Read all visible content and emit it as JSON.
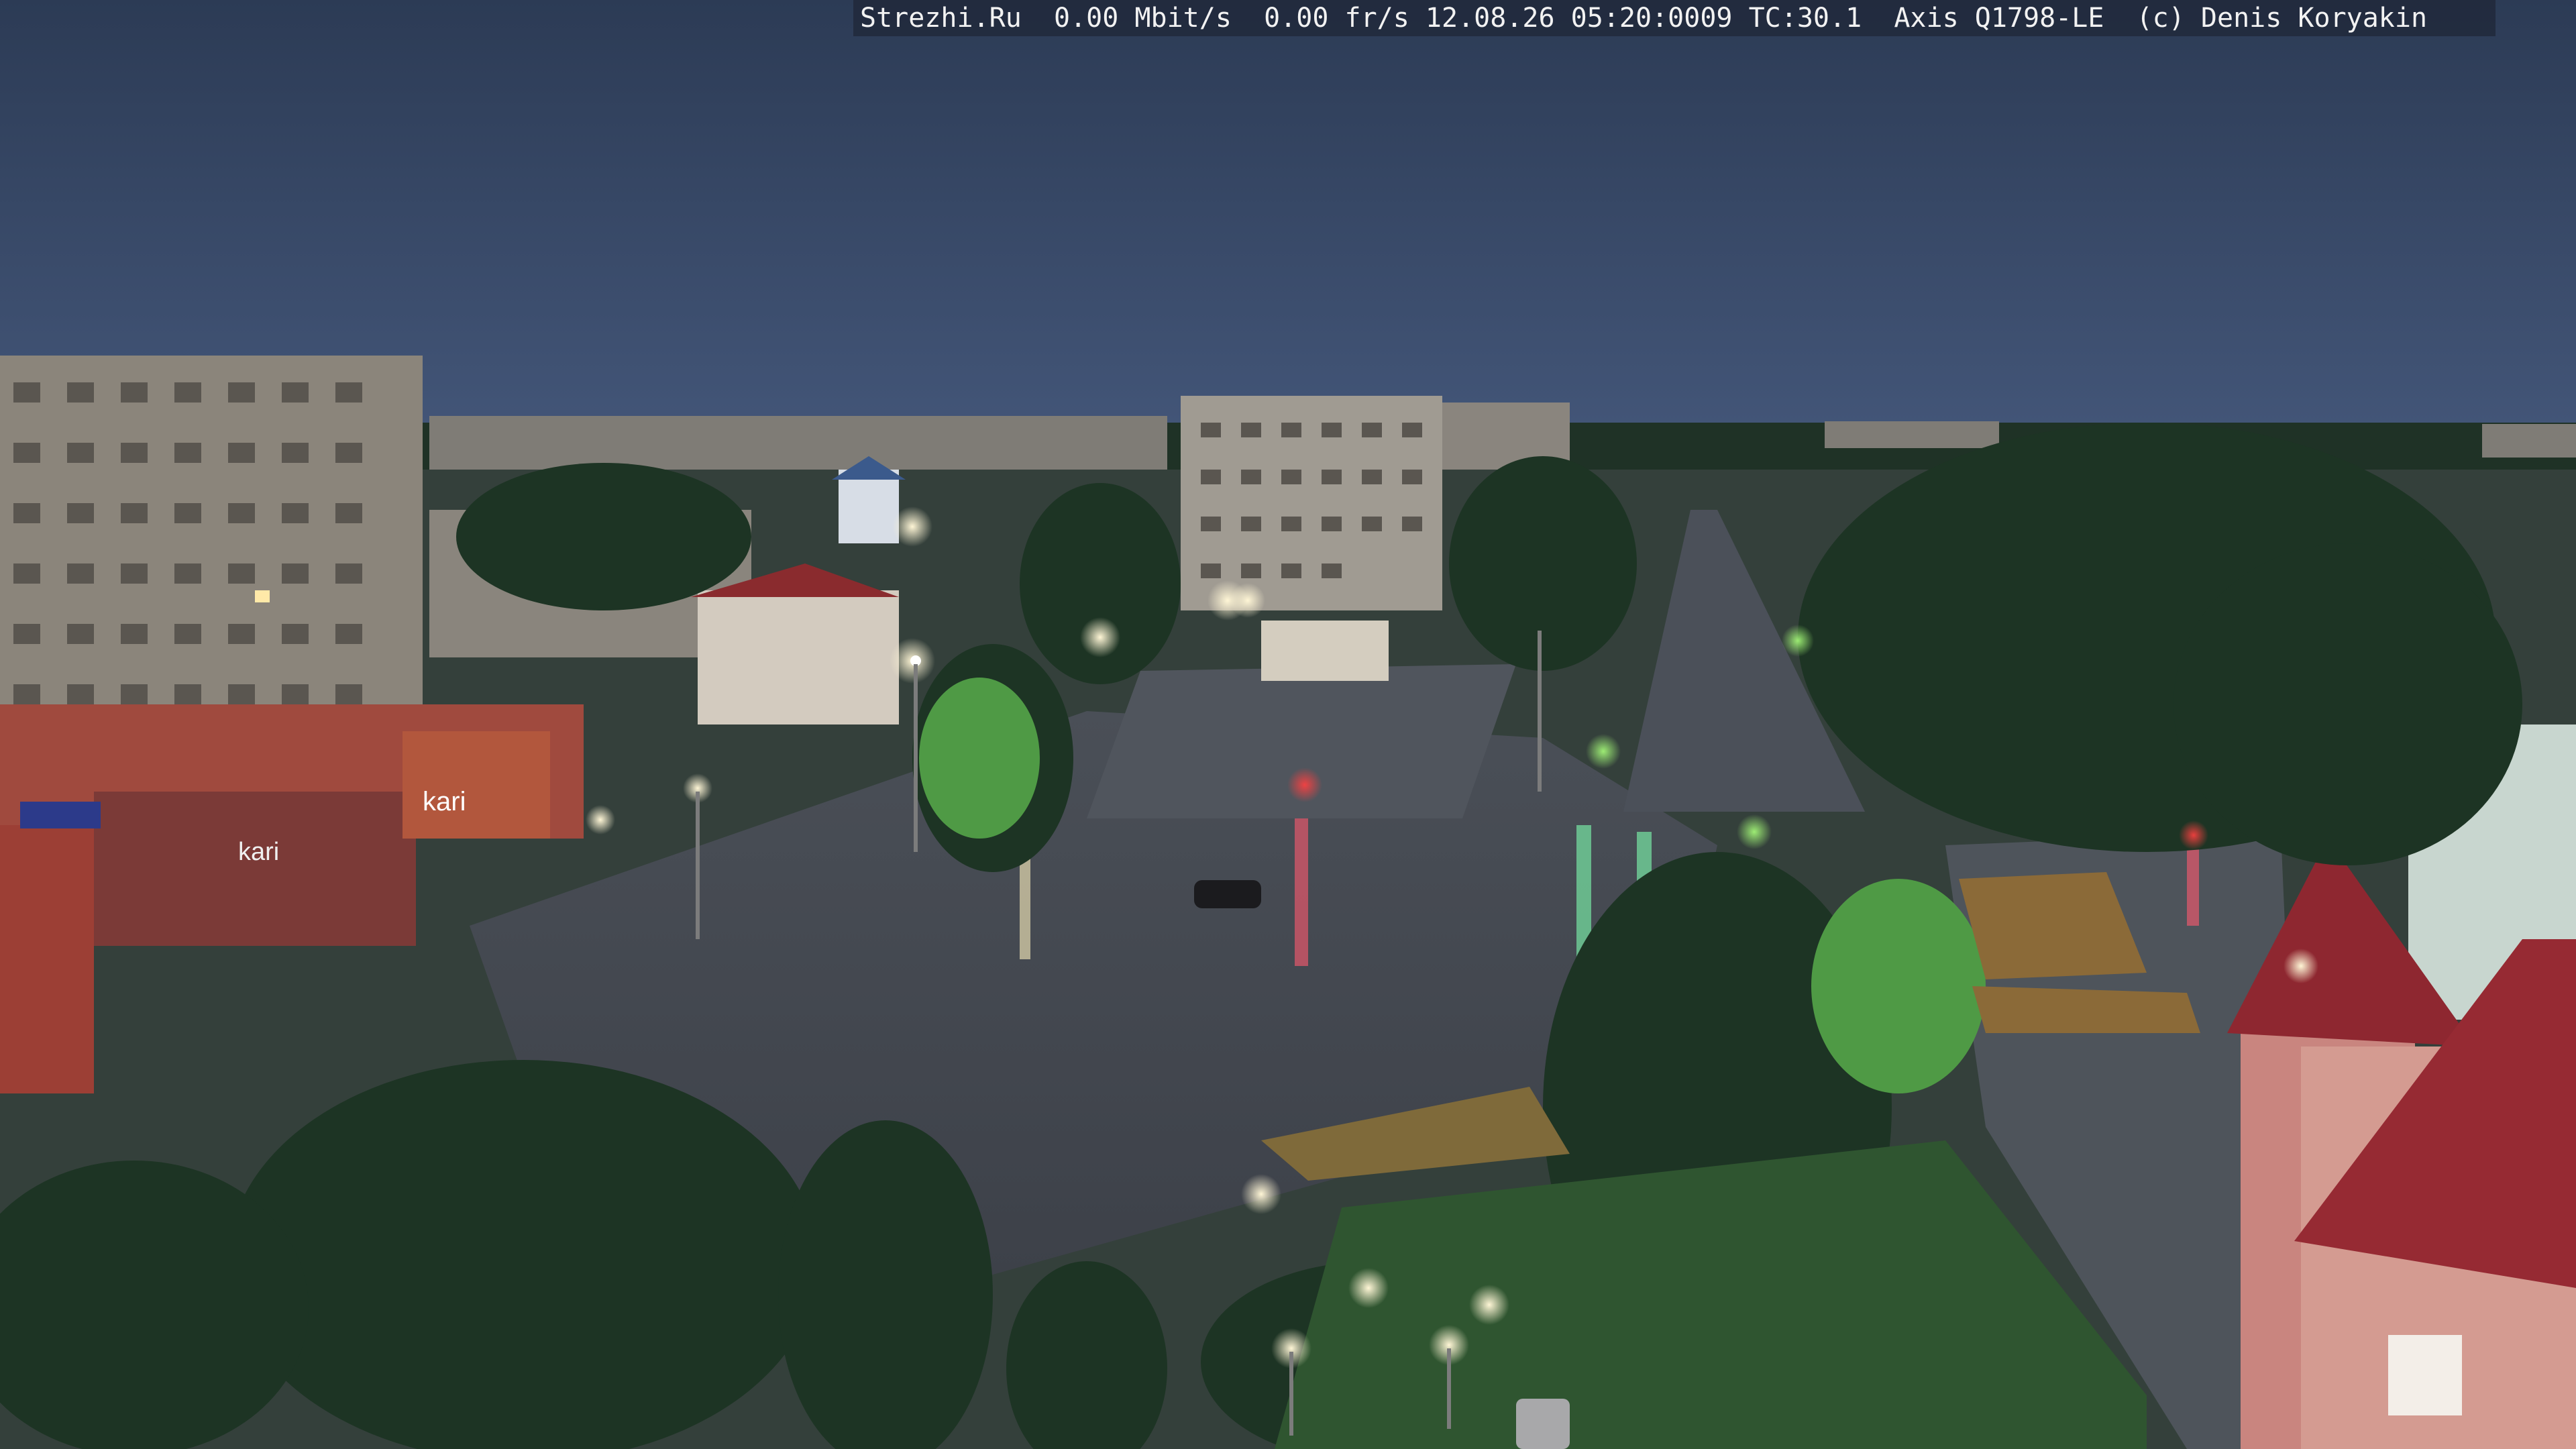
{
  "overlay": {
    "site": "Strezhi.Ru",
    "bitrate": "0.00 Mbit/s",
    "framerate": "0.00 fr/s",
    "datetime": "12.08.26 05:20:0009",
    "tc": "TC:30.1",
    "camera": "Axis Q1798-LE",
    "copyright": "(c) Denis Koryakin"
  },
  "signs": {
    "kari_left": "kari",
    "kari_right": "kari"
  },
  "colors": {
    "sky_top": "#2e3d57",
    "sky_horizon": "#3e5070",
    "asphalt": "#5a5f66",
    "trees": "#1e3325",
    "building": "#8a8479",
    "brick": "#a0433a",
    "lamp": "#fff4d0"
  }
}
